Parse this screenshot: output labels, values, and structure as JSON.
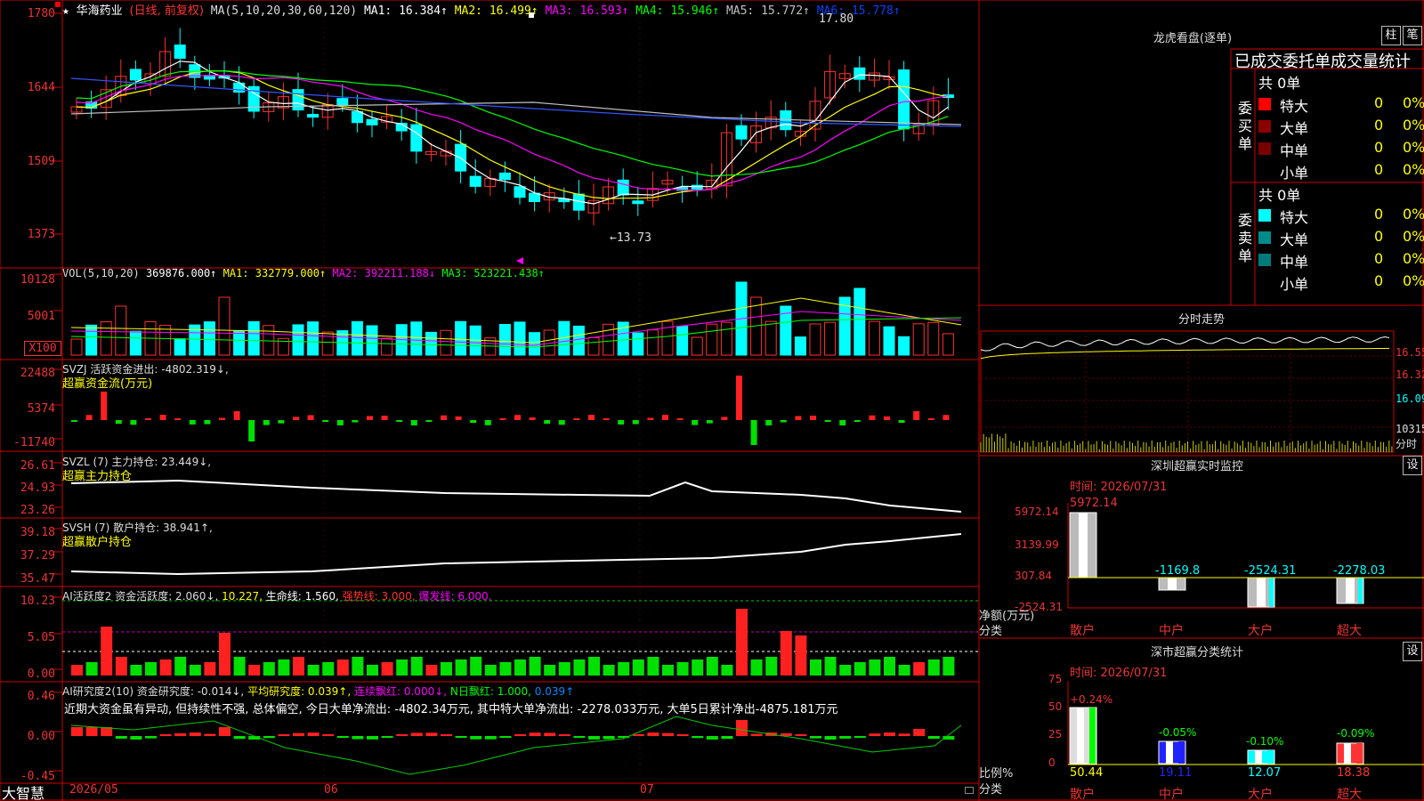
{
  "stock": {
    "star": "★",
    "name": "华海药业",
    "mode": "(日线, 前复权)"
  },
  "ma": {
    "label": "MA(5,10,20,30,60,120)",
    "items": [
      {
        "text": "MA1: 16.384↑",
        "color": "#ffffff"
      },
      {
        "text": "MA2: 16.499↑",
        "color": "#ffff00"
      },
      {
        "text": "MA3: 16.593↑",
        "color": "#ff00ff"
      },
      {
        "text": "MA4: 15.946↑",
        "color": "#00ff00"
      },
      {
        "text": "MA5: 15.772↑",
        "color": "#c0c0c0"
      },
      {
        "text": "MA6: 15.778↑",
        "color": "#0044ff"
      }
    ]
  },
  "price_axis": [
    "1780",
    "1644",
    "1509",
    "1373"
  ],
  "price_marks": {
    "high": "17.80",
    "low": "←13.73"
  },
  "vol": {
    "label": "VOL(5,10,20)",
    "value": "369876.000↑",
    "ma1": "MA1: 332779.000↑",
    "ma2": "MA2: 392211.188↓",
    "ma3": "MA3: 523221.438↑",
    "axis": [
      "10128",
      "5001"
    ],
    "unit": "X100"
  },
  "svzj": {
    "label": "SVZJ  活跃资金进出: -4802.319↓,",
    "sub": "超赢资金流(万元)",
    "axis": [
      "22488",
      "5374",
      "-11740"
    ]
  },
  "svzl": {
    "label": "SVZL (7) 主力持仓: 23.449↓,",
    "sub": "超赢主力持仓",
    "axis": [
      "26.61",
      "24.93",
      "23.26"
    ]
  },
  "svsh": {
    "label": "SVSH (7) 散户持仓: 38.941↑,",
    "sub": "超赢散户持仓",
    "axis": [
      "39.18",
      "37.29",
      "35.47"
    ]
  },
  "ai1": {
    "label": "AI活跃度2 资金活跃度: 2.060↓,",
    "v2": "10.227,",
    "v3": "生命线: 1.560,",
    "v4": "强势线: 3.000,",
    "v5": "爆发线: 6.000,",
    "axis": [
      "10.23",
      "5.05",
      "0.00"
    ]
  },
  "ai2": {
    "label": "AI研究度2(10) 资金研究度: -0.014↓,",
    "v2": "平均研究度: 0.039↑,",
    "v3": "连续飘红: 0.000↓,",
    "v4": "N日飘红: 1.000,",
    "v5": "0.039↑",
    "comment": "近期大资金虽有异动, 但持续性不强, 总体偏空, 今日大单净流出: -4802.34万元, 其中特大单净流出: -2278.033万元, 大单5日累计净出-4875.181万元",
    "axis": [
      "0.46",
      "0.00",
      "-0.45"
    ]
  },
  "dates": [
    "2026/05",
    "06",
    "07"
  ],
  "brand": "大智慧",
  "lhb": {
    "title": "龙虎看盘(逐单)",
    "btn1": "柱",
    "btn2": "笔",
    "tabs": "已成交委托单成交量统计",
    "buy_label": "委买单",
    "sell_label": "委卖单",
    "buy_total": "共 0单",
    "sell_total": "共 0单",
    "rows": [
      "特大",
      "大单",
      "中单",
      "小单"
    ],
    "zero": "0",
    "pct": "0%",
    "buy_colors": [
      "#ff0000",
      "#8b0000",
      "#7a0000",
      "#000000"
    ],
    "sell_colors": [
      "#00ffff",
      "#008b8b",
      "#007a7a",
      "#000000"
    ]
  },
  "intraday": {
    "title": "分时走势",
    "axis": [
      "16.55",
      "16.32",
      "16.09",
      "10315",
      "分时"
    ]
  },
  "sz_monitor": {
    "title": "深圳超赢实时监控",
    "btn": "设",
    "time": "时间: 2026/07/31",
    "axis": [
      "5972.14",
      "3139.99",
      "307.84",
      "-2524.31"
    ],
    "ylabel": "净额(万元)",
    "xlabel": "分类",
    "values": [
      "5972.14",
      "-1169.8",
      "-2524.31",
      "-2278.03"
    ],
    "cats": [
      "散户",
      "中户",
      "大户",
      "超大"
    ]
  },
  "sz_class": {
    "title": "深市超赢分类统计",
    "btn": "设",
    "time": "时间: 2026/07/31",
    "axis": [
      "75",
      "50",
      "25",
      "0"
    ],
    "ylabel": "比例%",
    "xlabel": "分类",
    "changes": [
      "+0.24%",
      "-0.05%",
      "-0.10%",
      "-0.09%"
    ],
    "values": [
      "50.44",
      "19.11",
      "12.07",
      "18.38"
    ],
    "cats": [
      "散户",
      "中户",
      "大户",
      "超大"
    ]
  }
}
